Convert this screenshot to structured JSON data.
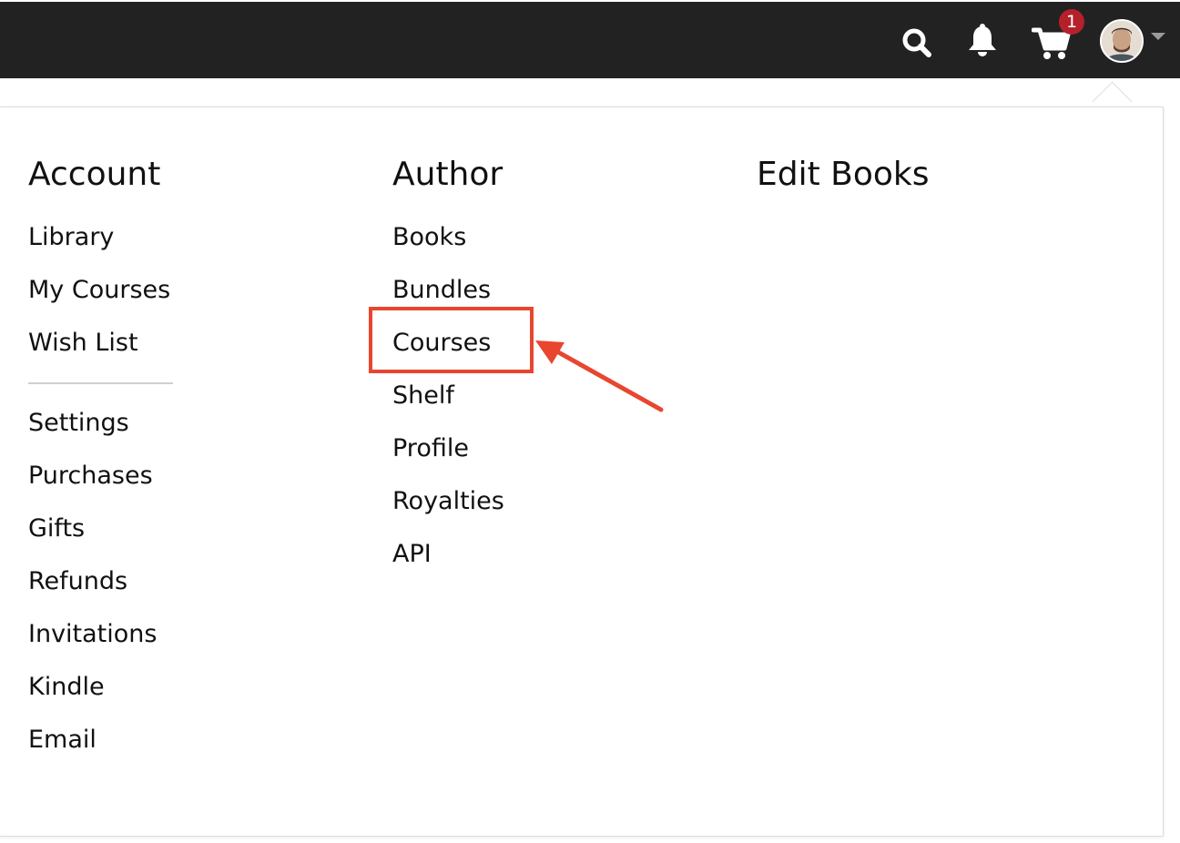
{
  "header": {
    "cart_count": "1"
  },
  "icons": {
    "search": "search-icon",
    "bell": "bell-icon",
    "cart": "cart-icon",
    "avatar": "avatar",
    "caret": "caret-down-icon"
  },
  "colors": {
    "topbar": "#222222",
    "badge": "#b5212b",
    "annotation": "#e8462f"
  },
  "menu": {
    "account": {
      "heading": "Account",
      "items_top": [
        "Library",
        "My Courses",
        "Wish List"
      ],
      "items_bottom": [
        "Settings",
        "Purchases",
        "Gifts",
        "Refunds",
        "Invitations",
        "Kindle",
        "Email"
      ]
    },
    "author": {
      "heading": "Author",
      "items": [
        "Books",
        "Bundles",
        "Courses",
        "Shelf",
        "Profile",
        "Royalties",
        "API"
      ]
    },
    "edit_books": {
      "heading": "Edit Books"
    }
  },
  "annotation": {
    "highlighted_item": "Courses"
  }
}
